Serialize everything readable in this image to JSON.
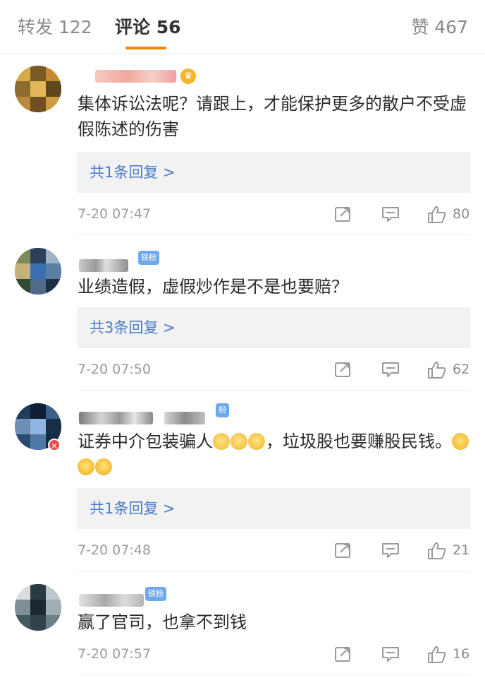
{
  "tabs": {
    "repost": "转发 122",
    "comments": "评论 56",
    "likes": "赞 467"
  },
  "comments": [
    {
      "text": "集体诉讼法呢？请跟上，才能保护更多的散户不受虚假陈述的伤害",
      "reply_link": "共1条回复 >",
      "time": "7-20 07:47",
      "likes": "80",
      "badge": ""
    },
    {
      "text": "业绩造假，虚假炒作是不是也要赔？",
      "reply_link": "共3条回复 >",
      "time": "7-20 07:50",
      "likes": "62",
      "badge": "铁粉"
    },
    {
      "text_part1": "证券中介包装骗人",
      "text_part2": "，垃圾股也要赚股民钱。",
      "reply_link": "共1条回复 >",
      "time": "7-20 07:48",
      "likes": "21",
      "badge": "粉"
    },
    {
      "text": "赢了官司，也拿不到钱",
      "time": "7-20 07:57",
      "likes": "16",
      "badge": "铁粉"
    }
  ],
  "icons": {
    "share": "share-icon",
    "comment": "comment-icon",
    "like": "thumbs-up-icon",
    "crown": "crown-icon"
  },
  "colors": {
    "accent": "#ff8200",
    "link": "#4a7cc4",
    "badge": "#6ea9ee"
  }
}
